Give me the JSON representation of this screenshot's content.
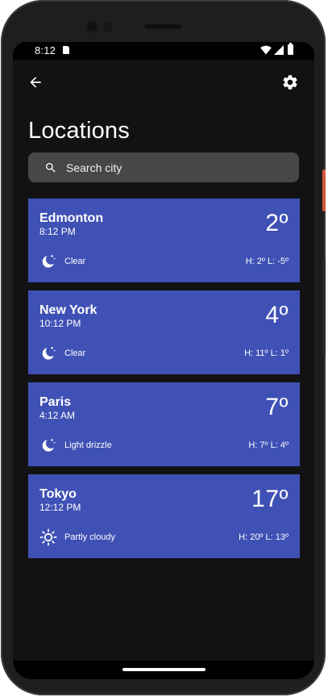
{
  "status_bar": {
    "time": "8:12",
    "icons": [
      "sd-card-icon",
      "wifi-icon",
      "signal-icon",
      "battery-icon"
    ]
  },
  "app_bar": {
    "back_icon": "arrow-left-icon",
    "settings_icon": "gear-icon"
  },
  "page": {
    "title": "Locations"
  },
  "search": {
    "placeholder": "Search city",
    "value": ""
  },
  "locations": [
    {
      "city": "Edmonton",
      "time": "8:12 PM",
      "temp": "2º",
      "condition": "Clear",
      "hilo": "H: 2º L: -5º",
      "icon": "moon-stars-icon"
    },
    {
      "city": "New York",
      "time": "10:12 PM",
      "temp": "4º",
      "condition": "Clear",
      "hilo": "H: 11º L: 1º",
      "icon": "moon-stars-icon"
    },
    {
      "city": "Paris",
      "time": "4:12 AM",
      "temp": "7º",
      "condition": "Light drizzle",
      "hilo": "H: 7º L: 4º",
      "icon": "moon-stars-icon"
    },
    {
      "city": "Tokyo",
      "time": "12:12 PM",
      "temp": "17º",
      "condition": "Partly cloudy",
      "hilo": "H: 20º L: 13º",
      "icon": "sun-icon"
    }
  ],
  "colors": {
    "card_background": "#3f51b5",
    "screen_background": "#121212",
    "search_background": "#474747",
    "phone_accent": "#d2583a"
  }
}
